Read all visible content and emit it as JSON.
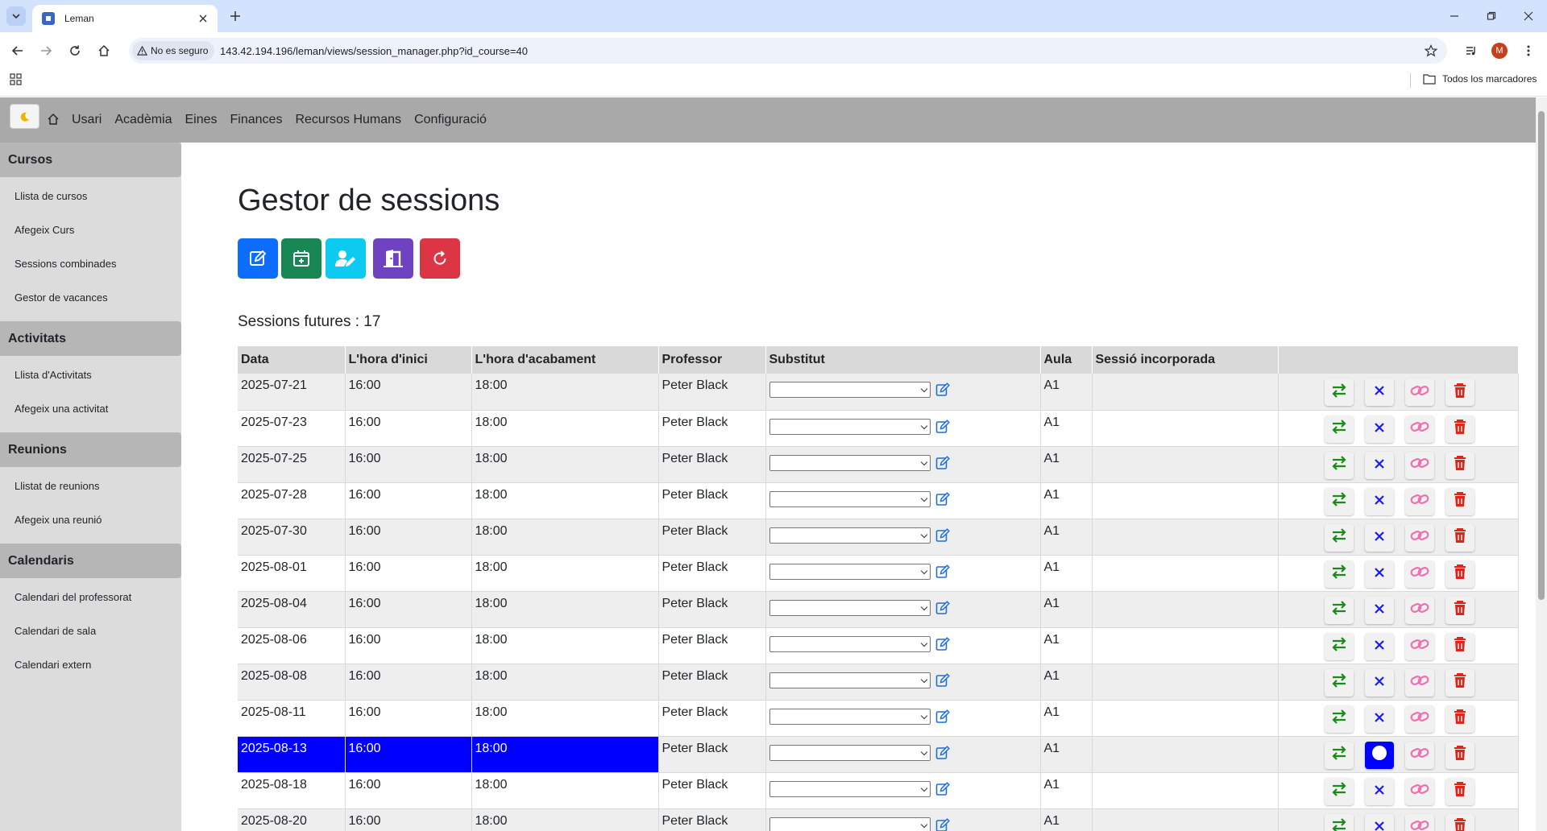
{
  "browser": {
    "tab_title": "Leman",
    "security_label": "No es seguro",
    "url": "143.42.194.196/leman/views/session_manager.php?id_course=40",
    "profile_initial": "M",
    "bookmarks_all": "Todos los marcadores"
  },
  "nav": {
    "menu": [
      "Usari",
      "Acadèmia",
      "Eines",
      "Finances",
      "Recursos Humans",
      "Configuració"
    ]
  },
  "sidebar": {
    "sections": [
      {
        "title": "Cursos",
        "items": [
          "Llista de cursos",
          "Afegeix Curs",
          "Sessions combinades",
          "Gestor de vacances"
        ]
      },
      {
        "title": "Activitats",
        "items": [
          "Llista d'Activitats",
          "Afegeix una activitat"
        ]
      },
      {
        "title": "Reunions",
        "items": [
          "Llistat de reunions",
          "Afegeix una reunió"
        ]
      },
      {
        "title": "Calendaris",
        "items": [
          "Calendari del professorat",
          "Calendari de sala",
          "Calendari extern"
        ]
      }
    ]
  },
  "main": {
    "title": "Gestor de sessions",
    "action_colors": {
      "edit": "#0d6efd",
      "calendar": "#198754",
      "teacher": "#0dcaf0",
      "room": "#6f42c1",
      "refresh": "#dc3545"
    },
    "sessions_label": "Sessions futures : 17",
    "table": {
      "headers": [
        "Data",
        "L'hora d'inici",
        "L'hora d'acabament",
        "Professor",
        "Substitut",
        "Aula",
        "Sessió incorporada",
        ""
      ],
      "rows": [
        {
          "date": "2025-07-21",
          "start": "16:00",
          "end": "18:00",
          "professor": "Peter Black",
          "aula": "A1",
          "incorporated": ""
        },
        {
          "date": "2025-07-23",
          "start": "16:00",
          "end": "18:00",
          "professor": "Peter Black",
          "aula": "A1",
          "incorporated": ""
        },
        {
          "date": "2025-07-25",
          "start": "16:00",
          "end": "18:00",
          "professor": "Peter Black",
          "aula": "A1",
          "incorporated": ""
        },
        {
          "date": "2025-07-28",
          "start": "16:00",
          "end": "18:00",
          "professor": "Peter Black",
          "aula": "A1",
          "incorporated": ""
        },
        {
          "date": "2025-07-30",
          "start": "16:00",
          "end": "18:00",
          "professor": "Peter Black",
          "aula": "A1",
          "incorporated": ""
        },
        {
          "date": "2025-08-01",
          "start": "16:00",
          "end": "18:00",
          "professor": "Peter Black",
          "aula": "A1",
          "incorporated": ""
        },
        {
          "date": "2025-08-04",
          "start": "16:00",
          "end": "18:00",
          "professor": "Peter Black",
          "aula": "A1",
          "incorporated": ""
        },
        {
          "date": "2025-08-06",
          "start": "16:00",
          "end": "18:00",
          "professor": "Peter Black",
          "aula": "A1",
          "incorporated": ""
        },
        {
          "date": "2025-08-08",
          "start": "16:00",
          "end": "18:00",
          "professor": "Peter Black",
          "aula": "A1",
          "incorporated": ""
        },
        {
          "date": "2025-08-11",
          "start": "16:00",
          "end": "18:00",
          "professor": "Peter Black",
          "aula": "A1",
          "incorporated": ""
        },
        {
          "date": "2025-08-13",
          "start": "16:00",
          "end": "18:00",
          "professor": "Peter Black",
          "aula": "A1",
          "incorporated": "",
          "highlighted": true
        },
        {
          "date": "2025-08-18",
          "start": "16:00",
          "end": "18:00",
          "professor": "Peter Black",
          "aula": "A1",
          "incorporated": ""
        },
        {
          "date": "2025-08-20",
          "start": "16:00",
          "end": "18:00",
          "professor": "Peter Black",
          "aula": "A1",
          "incorporated": ""
        }
      ]
    }
  },
  "row_action_icons": [
    "swap-icon",
    "cancel-icon",
    "link-icon",
    "trash-icon"
  ],
  "highlight_color": "#0000ff"
}
